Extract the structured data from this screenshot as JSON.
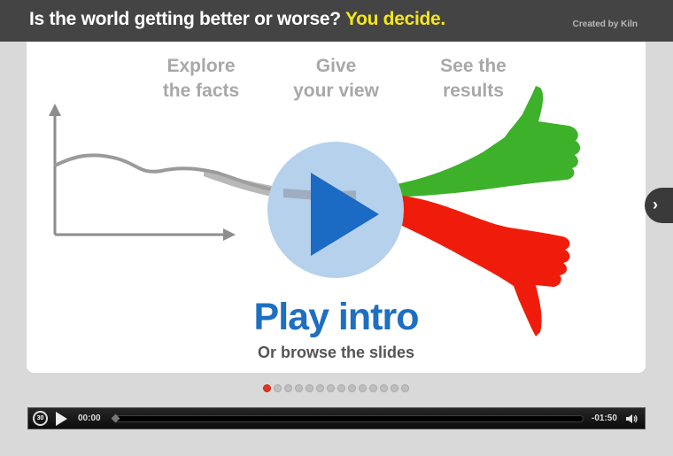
{
  "header": {
    "title_main": "Is the world getting better or worse?",
    "title_accent": "You decide.",
    "credit": "Created by Kiln"
  },
  "steps": [
    {
      "label": "Explore\nthe facts"
    },
    {
      "label": "Give\nyour view"
    },
    {
      "label": "See the\nresults"
    }
  ],
  "hero": {
    "play_label": "Play intro",
    "browse_label": "Or browse the slides"
  },
  "nav": {
    "next_glyph": "›"
  },
  "slides": {
    "count": 14,
    "active_index": 0
  },
  "player": {
    "rewind_label": "30",
    "current_time": "00:00",
    "remaining_time": "-01:50",
    "progress": 0
  },
  "colors": {
    "topbar": "#444444",
    "accent_yellow": "#f5e61b",
    "play_blue": "#1e6fc0",
    "thumbs_up": "#3db12a",
    "thumbs_down": "#f01c0b",
    "active_dot": "#e0351f"
  },
  "icons": {
    "next": "chevron-right-icon",
    "rewind": "rewind-30-icon",
    "play": "play-icon",
    "volume": "volume-icon",
    "thumbs_up": "thumbs-up-icon",
    "thumbs_down": "thumbs-down-icon"
  }
}
